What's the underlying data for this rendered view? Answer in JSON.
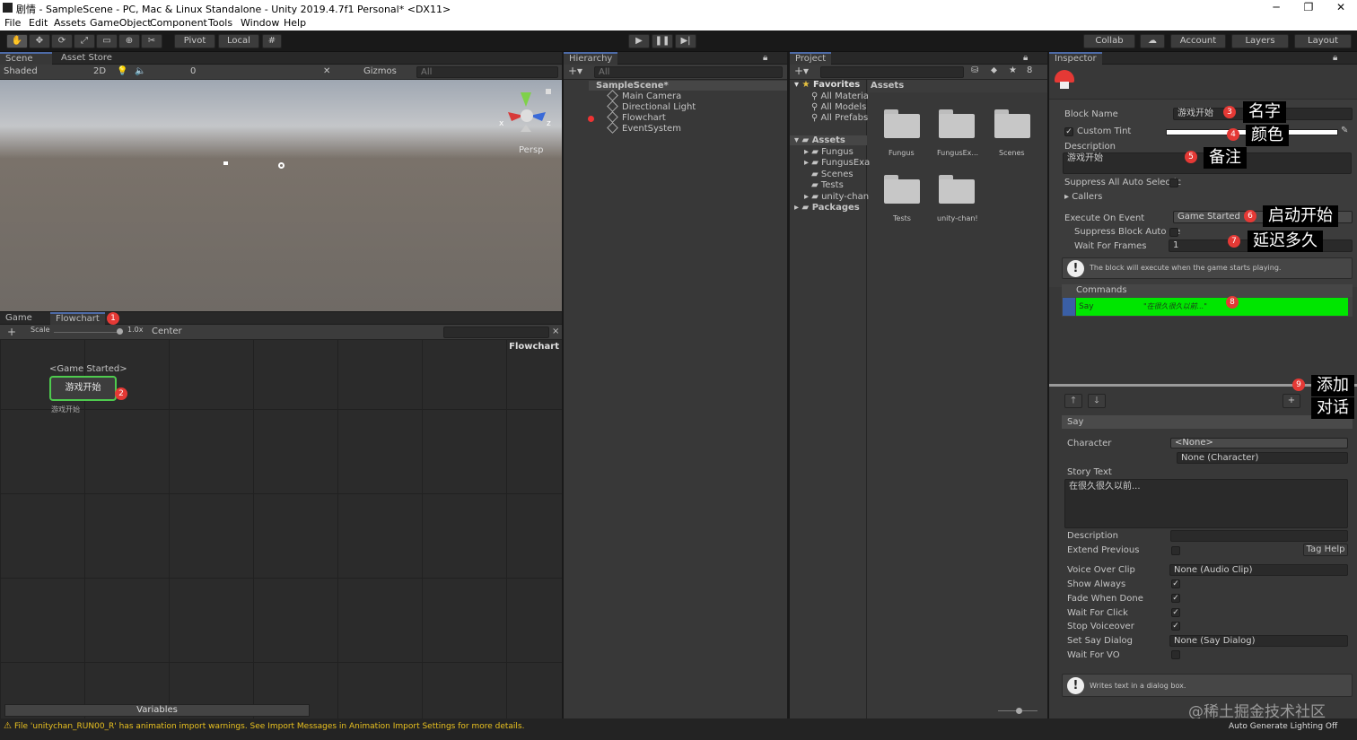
{
  "window": {
    "title": "剧情 - SampleScene - PC, Mac & Linux Standalone - Unity 2019.4.7f1 Personal* <DX11>",
    "minimize": "─",
    "maximize": "❐",
    "close": "✕"
  },
  "menu": [
    "File",
    "Edit",
    "Assets",
    "GameObject",
    "Component",
    "Tools",
    "Window",
    "Help"
  ],
  "toolbar": {
    "pivot": "Pivot",
    "local": "Local",
    "collab": "Collab",
    "account": "Account",
    "layers": "Layers",
    "layout": "Layout"
  },
  "scene": {
    "tabs": [
      "Scene",
      "Asset Store"
    ],
    "shading": "Shaded",
    "mode2d": "2D",
    "fx_count": "0",
    "gizmos": "Gizmos",
    "search_placeholder": "All",
    "persp": "Persp",
    "axis_x": "x",
    "axis_z": "z"
  },
  "flowchart": {
    "tabs": [
      "Game",
      "Flowchart"
    ],
    "scale_label": "Scale",
    "scale_value": "1.0x",
    "center": "Center",
    "title": "Flowchart",
    "block_event": "<Game Started>",
    "block_name": "游戏开始",
    "block_desc": "游戏开始",
    "variables": "Variables"
  },
  "hierarchy": {
    "tab": "Hierarchy",
    "search_placeholder": "All",
    "scene": "SampleScene*",
    "items": [
      "Main Camera",
      "Directional Light",
      "Flowchart",
      "EventSystem"
    ]
  },
  "project": {
    "tab": "Project",
    "favorites": "Favorites",
    "fav_items": [
      "All Materia",
      "All Models",
      "All Prefabs"
    ],
    "assets": "Assets",
    "asset_folders": [
      "Fungus",
      "FungusExa",
      "Scenes",
      "Tests",
      "unity-chan"
    ],
    "packages": "Packages",
    "grid_header": "Assets",
    "grid": [
      "Fungus",
      "FungusEx...",
      "Scenes",
      "Tests",
      "unity-chan!"
    ],
    "hidden_count": "8"
  },
  "inspector": {
    "tab": "Inspector",
    "block_name_label": "Block Name",
    "block_name": "游戏开始",
    "custom_tint_label": "Custom Tint",
    "description_label": "Description",
    "description": "游戏开始",
    "suppress_all": "Suppress All Auto Selectic",
    "callers": "Callers",
    "execute_on_event_label": "Execute On Event",
    "execute_on_event": "Game Started",
    "suppress_block": "Suppress Block Auto Se",
    "wait_for_frames_label": "Wait For Frames",
    "wait_for_frames": "1",
    "event_help": "The block will execute when the game starts playing.",
    "commands_label": "Commands",
    "command_name": "Say",
    "command_summary": "\"在很久很久以前...\"",
    "up": "🡑",
    "down": "🡓",
    "plus": "+",
    "say_header": "Say",
    "character_label": "Character",
    "character": "<None>",
    "character_obj": "None (Character)",
    "story_text_label": "Story Text",
    "story_text": "在很久很久以前...",
    "desc2_label": "Description",
    "extend_previous": "Extend Previous",
    "tag_help": "Tag Help",
    "voice_over_clip": "Voice Over Clip",
    "voice_over_value": "None (Audio Clip)",
    "show_always": "Show Always",
    "fade_when_done": "Fade When Done",
    "wait_for_click": "Wait For Click",
    "stop_voiceover": "Stop Voiceover",
    "set_say_dialog": "Set Say Dialog",
    "set_say_dialog_value": "None (Say Dialog)",
    "wait_for_vo": "Wait For VO",
    "say_help": "Writes text in a dialog box."
  },
  "annotations": {
    "n1": "1",
    "n2": "2",
    "n3": "3",
    "n4": "4",
    "n5": "5",
    "n6": "6",
    "n7": "7",
    "n8": "8",
    "n9": "9",
    "a_name": "名字",
    "a_color": "颜色",
    "a_note": "备注",
    "a_start": "启动开始",
    "a_delay": "延迟多久",
    "a_add1": "添加",
    "a_add2": "对话"
  },
  "status": {
    "warning": "File 'unitychan_RUN00_R' has animation import warnings. See Import Messages in Animation Import Settings for more details.",
    "lighting": "Auto Generate Lighting Off",
    "watermark": "@稀土掘金技术社区"
  },
  "colors": {
    "accent": "#4d6aa6",
    "say_green": "#00e600",
    "badge": "#e53935",
    "flow_border": "#4ecb4e"
  }
}
